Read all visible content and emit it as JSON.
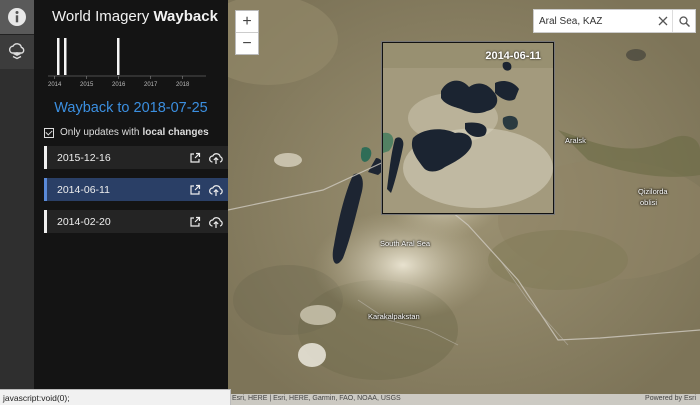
{
  "rail": {
    "info_icon": "info-icon",
    "layers_icon": "layers-icon"
  },
  "panel": {
    "title_light": "World Imagery",
    "title_bold": "Wayback",
    "timeline_years": [
      "2014",
      "2015",
      "2016",
      "2017",
      "2018"
    ],
    "wayback_heading": "Wayback to 2018-07-25",
    "filter_label": "Only updates with",
    "filter_label_bold": "local changes",
    "releases": [
      {
        "date": "2015-12-16",
        "selected": false
      },
      {
        "date": "2014-06-11",
        "selected": true
      },
      {
        "date": "2014-02-20",
        "selected": false
      }
    ]
  },
  "map": {
    "zoom_in": "+",
    "zoom_out": "−",
    "search_value": "Aral Sea, KAZ",
    "inset_date": "2014-06-11",
    "labels": {
      "aralsk": "Aralsk",
      "qizilorda": "Qizilorda",
      "qizilorda_2": "oblisi",
      "south_aral": "South Aral Sea",
      "karakalpakstan": "Karakalpakstan"
    },
    "attribution": "Esri, HERE | Esri, HERE, Garmin, FAO, NOAA, USGS",
    "powered_by": "Powered by Esri"
  },
  "status_bar": "javascript:void(0);",
  "colors": {
    "accent": "#3b8fe0",
    "selected": "#2a3f66",
    "panel_bg": "#141414"
  }
}
